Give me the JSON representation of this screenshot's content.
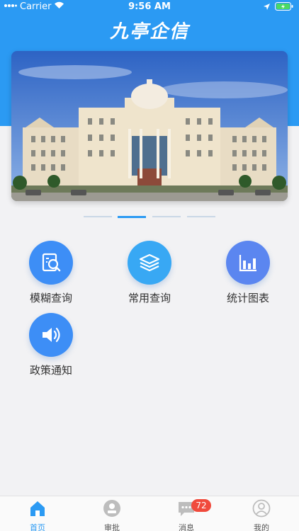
{
  "status_bar": {
    "carrier": "Carrier",
    "time": "9:56 AM"
  },
  "header": {
    "title": "九亭企信"
  },
  "menu": [
    {
      "label": "模糊查询",
      "icon": "search-doc-icon",
      "color": "#3d8ef6"
    },
    {
      "label": "常用查询",
      "icon": "layers-icon",
      "color": "#38a8f4"
    },
    {
      "label": "统计图表",
      "icon": "bar-chart-icon",
      "color": "#5b86f0"
    },
    {
      "label": "政策通知",
      "icon": "speaker-icon",
      "color": "#3d8ef6"
    }
  ],
  "tabbar": {
    "items": [
      {
        "label": "首页",
        "icon": "home-icon",
        "active": true
      },
      {
        "label": "审批",
        "icon": "approval-icon",
        "active": false
      },
      {
        "label": "消息",
        "icon": "message-icon",
        "active": false,
        "badge": "72"
      },
      {
        "label": "我的",
        "icon": "profile-icon",
        "active": false
      }
    ]
  },
  "colors": {
    "primary": "#2b9af3",
    "badge": "#f04a3c"
  }
}
